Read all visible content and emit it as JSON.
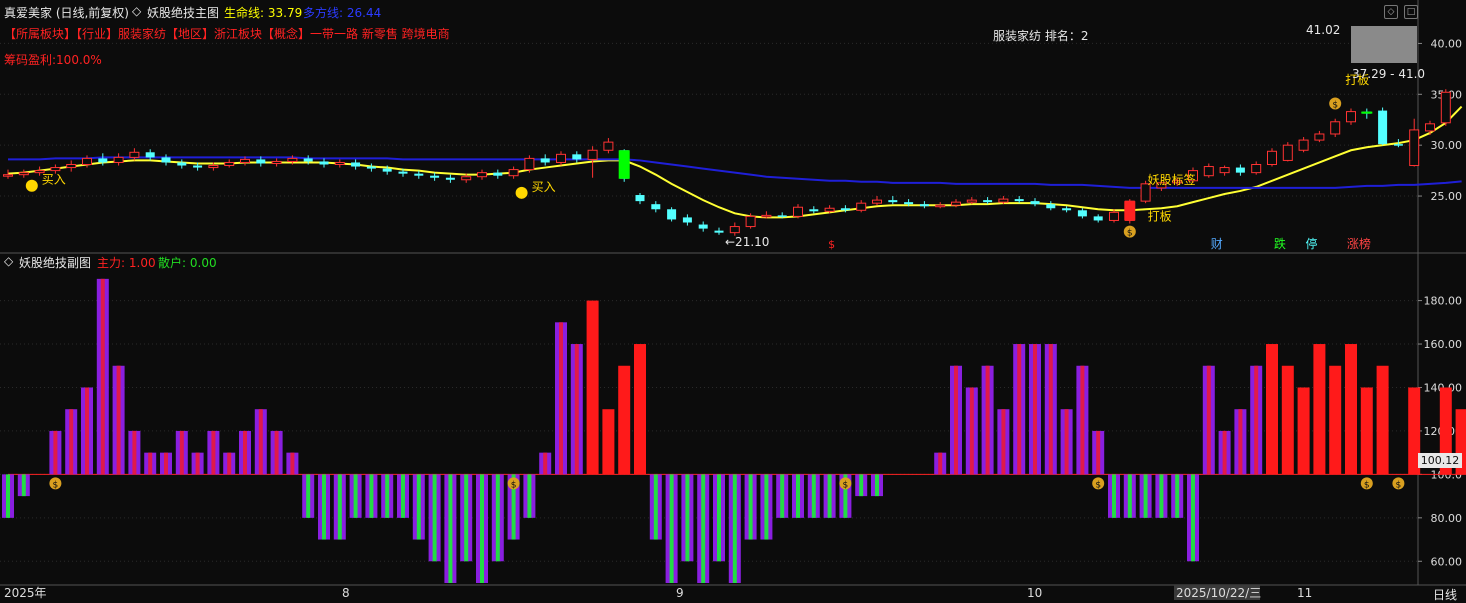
{
  "header": {
    "stock_title": "真爱美家 (日线,前复权)",
    "main_indicator_name": "妖股绝技主图",
    "life_line_label": "生命线:",
    "life_line_value": "33.79",
    "bull_line_label": "多方线:",
    "bull_line_value": "26.44",
    "sector_info": "【所属板块】【行业】服装家纺【地区】浙江板块【概念】一带一路 新零售 跨境电商",
    "chip_profit": "筹码盈利:100.0%",
    "ranking": "服装家纺 排名：2"
  },
  "sub_header": {
    "indicator_name": "妖股绝技副图",
    "main_force_label": "主力:",
    "main_force_value": "1.00",
    "retail_label": "散户:",
    "retail_value": "0.00"
  },
  "annotations": {
    "buy_label": "买入",
    "low_price": "←21.10",
    "yaogu_signal": "妖股标签",
    "daban_label": "打板",
    "price_high": "41.02",
    "price_range": "37.29 - 41.0",
    "sub_last_value": "100.12",
    "tag_cai": "财",
    "tag_die": "跌",
    "tag_ting": "停",
    "tag_zhang": "涨榜",
    "dollar_mark": "$"
  },
  "footer": {
    "date_labels": [
      "2025年",
      "8",
      "9",
      "10",
      "2025/10/22/三",
      "11"
    ],
    "period": "日线"
  },
  "colors": {
    "up": "#ff3333",
    "down": "#54ffff",
    "life_line": "#ffff33",
    "bull_line": "#1f1fd8",
    "background": "#0c0c0c",
    "grid": "#2a2a2a"
  },
  "chart_data": [
    {
      "type": "candlestick",
      "title": "妖股绝技主图",
      "ylim": [
        19.5,
        42.5
      ],
      "yticks": [
        25,
        30,
        35,
        40
      ],
      "ytick_labels": [
        "25.00",
        "30.00",
        "35.00",
        "40.00"
      ],
      "candles": [
        [
          27.0,
          27.1,
          27.6,
          26.7
        ],
        [
          27.1,
          27.3,
          27.6,
          26.8
        ],
        [
          27.3,
          27.5,
          27.9,
          27.0
        ],
        [
          27.5,
          27.8,
          28.1,
          27.2
        ],
        [
          27.8,
          28.1,
          28.5,
          27.4
        ],
        [
          28.1,
          28.7,
          29.0,
          27.8
        ],
        [
          28.7,
          28.3,
          29.2,
          28.0
        ],
        [
          28.3,
          28.8,
          29.2,
          28.0
        ],
        [
          28.8,
          29.3,
          29.7,
          28.5
        ],
        [
          29.3,
          28.8,
          29.6,
          28.5
        ],
        [
          28.8,
          28.3,
          29.1,
          28.0
        ],
        [
          28.3,
          28.0,
          28.6,
          27.7
        ],
        [
          28.0,
          27.8,
          28.3,
          27.5
        ],
        [
          27.8,
          28.0,
          28.3,
          27.5
        ],
        [
          28.0,
          28.3,
          28.6,
          27.8
        ],
        [
          28.3,
          28.6,
          28.9,
          28.0
        ],
        [
          28.6,
          28.2,
          28.9,
          27.9
        ],
        [
          28.2,
          28.4,
          28.7,
          27.9
        ],
        [
          28.4,
          28.7,
          29.0,
          28.1
        ],
        [
          28.7,
          28.4,
          29.0,
          28.1
        ],
        [
          28.4,
          28.1,
          28.7,
          27.8
        ],
        [
          28.1,
          28.3,
          28.6,
          27.8
        ],
        [
          28.3,
          27.9,
          28.6,
          27.6
        ],
        [
          27.9,
          27.7,
          28.2,
          27.4
        ],
        [
          27.7,
          27.4,
          28.0,
          27.1
        ],
        [
          27.4,
          27.2,
          27.7,
          26.9
        ],
        [
          27.2,
          27.0,
          27.5,
          26.7
        ],
        [
          27.0,
          26.8,
          27.3,
          26.5
        ],
        [
          26.8,
          26.6,
          27.1,
          26.3
        ],
        [
          26.6,
          26.9,
          27.2,
          26.3
        ],
        [
          26.9,
          27.3,
          27.6,
          26.6
        ],
        [
          27.3,
          27.0,
          27.6,
          26.7
        ],
        [
          27.0,
          27.6,
          27.9,
          26.7
        ],
        [
          27.6,
          28.7,
          29.0,
          27.3
        ],
        [
          28.7,
          28.3,
          29.1,
          28.0
        ],
        [
          28.3,
          29.1,
          29.4,
          28.0
        ],
        [
          29.1,
          28.6,
          29.4,
          28.3
        ],
        [
          28.6,
          29.5,
          29.9,
          26.8
        ],
        [
          29.5,
          30.3,
          30.7,
          29.2
        ],
        [
          29.5,
          26.7,
          29.6,
          26.4
        ],
        [
          25.1,
          24.5,
          25.3,
          24.2
        ],
        [
          24.2,
          23.7,
          24.5,
          23.4
        ],
        [
          23.7,
          22.7,
          23.9,
          22.5
        ],
        [
          22.9,
          22.4,
          23.2,
          22.1
        ],
        [
          22.2,
          21.8,
          22.5,
          21.5
        ],
        [
          21.6,
          21.4,
          21.9,
          21.2
        ],
        [
          21.4,
          22.0,
          22.4,
          21.1
        ],
        [
          22.0,
          23.0,
          23.3,
          21.8
        ],
        [
          23.0,
          23.1,
          23.5,
          22.8
        ],
        [
          23.1,
          23.0,
          23.4,
          22.8
        ],
        [
          23.0,
          23.9,
          24.2,
          22.8
        ],
        [
          23.7,
          23.5,
          24.0,
          23.3
        ],
        [
          23.5,
          23.8,
          24.1,
          23.3
        ],
        [
          23.8,
          23.6,
          24.1,
          23.4
        ],
        [
          23.6,
          24.3,
          24.6,
          23.4
        ],
        [
          24.3,
          24.6,
          25.0,
          24.1
        ],
        [
          24.6,
          24.4,
          25.0,
          24.2
        ],
        [
          24.4,
          24.2,
          24.7,
          24.0
        ],
        [
          24.2,
          24.0,
          24.5,
          23.8
        ],
        [
          24.0,
          24.1,
          24.4,
          23.8
        ],
        [
          24.1,
          24.4,
          24.7,
          23.9
        ],
        [
          24.4,
          24.6,
          24.9,
          24.2
        ],
        [
          24.6,
          24.4,
          24.9,
          24.2
        ],
        [
          24.4,
          24.7,
          25.0,
          24.2
        ],
        [
          24.7,
          24.5,
          25.0,
          24.3
        ],
        [
          24.5,
          24.2,
          24.8,
          24.0
        ],
        [
          24.2,
          23.8,
          24.5,
          23.6
        ],
        [
          23.8,
          23.6,
          24.0,
          23.4
        ],
        [
          23.6,
          23.0,
          23.8,
          22.8
        ],
        [
          23.0,
          22.6,
          23.2,
          22.4
        ],
        [
          22.6,
          23.4,
          23.7,
          22.4
        ],
        [
          22.6,
          24.5,
          24.7,
          22.3
        ],
        [
          24.5,
          26.2,
          26.5,
          24.3
        ],
        [
          25.8,
          26.3,
          26.6,
          25.5
        ],
        [
          26.3,
          26.5,
          26.8,
          26.0
        ],
        [
          26.5,
          27.5,
          27.8,
          26.3
        ],
        [
          27.0,
          27.9,
          28.2,
          26.8
        ],
        [
          27.3,
          27.8,
          28.0,
          27.0
        ],
        [
          27.8,
          27.3,
          28.1,
          27.0
        ],
        [
          27.3,
          28.1,
          28.4,
          27.1
        ],
        [
          28.1,
          29.4,
          29.7,
          27.9
        ],
        [
          28.5,
          30.0,
          30.3,
          28.4
        ],
        [
          29.5,
          30.5,
          30.8,
          29.3
        ],
        [
          30.5,
          31.1,
          31.4,
          30.3
        ],
        [
          31.1,
          32.3,
          32.6,
          30.8
        ],
        [
          32.3,
          33.3,
          33.6,
          32.0
        ],
        [
          33.3,
          33.1,
          33.6,
          32.6
        ],
        [
          33.4,
          30.1,
          33.7,
          30.0
        ],
        [
          30.1,
          30.0,
          30.6,
          29.8
        ],
        [
          28.0,
          31.5,
          32.6,
          27.9
        ],
        [
          31.4,
          32.1,
          32.4,
          31.0
        ],
        [
          32.2,
          35.2,
          35.5,
          31.9
        ]
      ],
      "series": [
        {
          "name": "生命线",
          "values": [
            27.2,
            27.3,
            27.5,
            27.7,
            27.9,
            28.1,
            28.3,
            28.4,
            28.5,
            28.5,
            28.4,
            28.3,
            28.2,
            28.2,
            28.2,
            28.3,
            28.3,
            28.3,
            28.3,
            28.3,
            28.3,
            28.2,
            28.1,
            27.9,
            27.8,
            27.6,
            27.5,
            27.3,
            27.2,
            27.1,
            27.1,
            27.2,
            27.3,
            27.6,
            27.8,
            28.0,
            28.2,
            28.4,
            28.5,
            28.5,
            27.9,
            27.1,
            26.2,
            25.4,
            24.6,
            23.9,
            23.3,
            23.0,
            22.9,
            22.9,
            23.0,
            23.2,
            23.4,
            23.6,
            23.8,
            24.0,
            24.1,
            24.1,
            24.1,
            24.1,
            24.1,
            24.2,
            24.2,
            24.3,
            24.3,
            24.3,
            24.2,
            24.1,
            23.9,
            23.7,
            23.6,
            23.6,
            23.7,
            23.8,
            24.0,
            24.4,
            24.8,
            25.2,
            25.5,
            25.9,
            26.5,
            27.1,
            27.7,
            28.3,
            28.9,
            29.5,
            29.8,
            30.0,
            30.2,
            30.5,
            31.2,
            32.2,
            33.8
          ]
        },
        {
          "name": "多方线",
          "values": [
            28.6,
            28.6,
            28.6,
            28.7,
            28.7,
            28.7,
            28.8,
            28.8,
            28.8,
            28.8,
            28.8,
            28.8,
            28.8,
            28.8,
            28.8,
            28.8,
            28.8,
            28.8,
            28.8,
            28.7,
            28.7,
            28.7,
            28.7,
            28.7,
            28.7,
            28.6,
            28.6,
            28.6,
            28.6,
            28.6,
            28.6,
            28.6,
            28.6,
            28.6,
            28.6,
            28.6,
            28.6,
            28.6,
            28.6,
            28.6,
            28.5,
            28.3,
            28.1,
            27.9,
            27.7,
            27.5,
            27.3,
            27.1,
            26.9,
            26.8,
            26.7,
            26.6,
            26.5,
            26.5,
            26.4,
            26.4,
            26.3,
            26.3,
            26.3,
            26.3,
            26.2,
            26.2,
            26.2,
            26.2,
            26.2,
            26.2,
            26.1,
            26.1,
            26.1,
            26.0,
            25.9,
            25.8,
            25.8,
            25.8,
            25.8,
            25.8,
            25.8,
            25.8,
            25.8,
            25.8,
            25.8,
            25.8,
            25.8,
            25.8,
            25.8,
            25.9,
            26.0,
            26.0,
            26.1,
            26.1,
            26.2,
            26.3,
            26.44
          ]
        }
      ]
    },
    {
      "type": "bar",
      "title": "妖股绝技副图",
      "baseline": 100,
      "ylim": [
        50,
        195
      ],
      "yticks": [
        60,
        80,
        100,
        120,
        140,
        160,
        180
      ],
      "ytick_labels": [
        "60.00",
        "80.00",
        "100.0",
        "120.00",
        "140.00",
        "160.00",
        "180.00"
      ],
      "values": [
        80,
        90,
        100,
        120,
        130,
        140,
        190,
        150,
        120,
        110,
        110,
        120,
        110,
        120,
        110,
        120,
        130,
        120,
        110,
        80,
        70,
        70,
        80,
        80,
        80,
        80,
        70,
        60,
        50,
        60,
        50,
        60,
        70,
        80,
        110,
        170,
        160,
        180,
        130,
        150,
        160,
        70,
        50,
        60,
        50,
        60,
        50,
        70,
        70,
        80,
        80,
        80,
        80,
        80,
        90,
        90,
        100,
        100,
        100,
        110,
        150,
        140,
        150,
        130,
        160,
        160,
        160,
        130,
        150,
        120,
        80,
        80,
        80,
        80,
        80,
        60,
        150,
        120,
        130,
        150,
        160,
        150,
        140,
        160,
        150,
        160,
        140,
        150,
        100,
        140,
        100,
        140,
        130,
        140
      ],
      "red_bars": [
        37,
        38,
        39,
        40,
        80,
        81,
        82,
        83,
        84,
        85,
        86,
        87,
        88,
        89,
        90,
        91,
        92,
        93
      ]
    }
  ]
}
